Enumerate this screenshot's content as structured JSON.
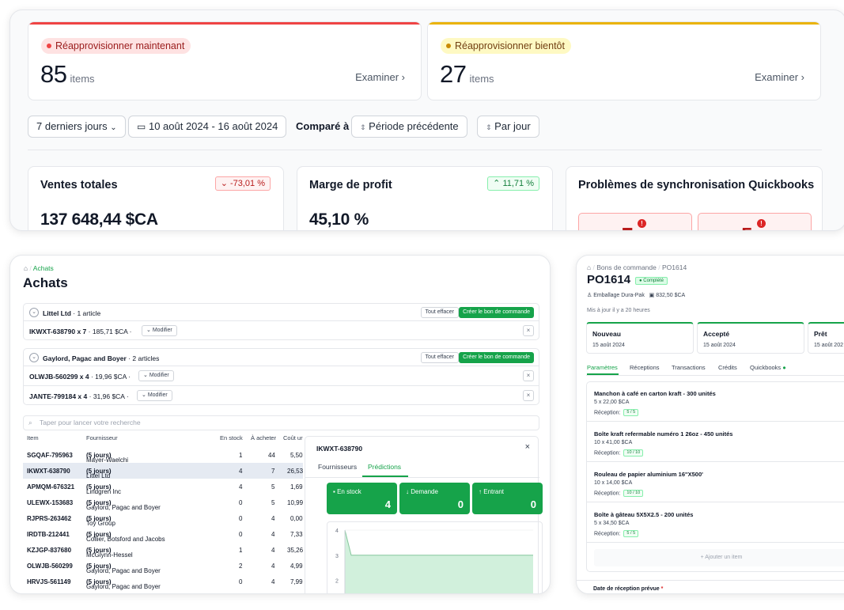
{
  "top": {
    "restock_now": {
      "label": "Réapprovisionner maintenant",
      "count": "85",
      "unit": "items",
      "action": "Examiner",
      "color": "#ef4444"
    },
    "restock_soon": {
      "label": "Réapprovisionner bientôt",
      "count": "27",
      "unit": "items",
      "action": "Examiner",
      "color": "#eab308"
    },
    "filters": {
      "range": "7 derniers jours",
      "dates": "10 août 2024 - 16 août 2024",
      "compare_label": "Comparé à",
      "compare": "Période précédente",
      "granularity": "Par jour"
    },
    "metrics": [
      {
        "title": "Ventes totales",
        "value": "137 648,44 $CA",
        "delta": "-73,01 %"
      },
      {
        "title": "Marge de profit",
        "value": "45,10 %",
        "delta": "11,71 %"
      },
      {
        "title": "Problèmes de synchronisation Quickbooks",
        "tiles": [
          "7",
          "5"
        ]
      }
    ]
  },
  "achats": {
    "breadcrumb": "Achats",
    "title": "Achats",
    "groups": [
      {
        "supplier": "Littel Ltd",
        "count": "1 article",
        "clear": "Tout effacer",
        "create": "Créer le bon de commande",
        "lines": [
          {
            "sku": "IKWXT-638790 x 7",
            "price": "185,71 $CA",
            "edit": "Modifier"
          }
        ]
      },
      {
        "supplier": "Gaylord, Pagac and Boyer",
        "count": "2 articles",
        "clear": "Tout effacer",
        "create": "Créer le bon de commande",
        "lines": [
          {
            "sku": "OLWJB-560299 x 4",
            "price": "19,96 $CA",
            "edit": "Modifier"
          },
          {
            "sku": "JANTE-799184 x 4",
            "price": "31,96 $CA",
            "edit": "Modifier"
          }
        ]
      }
    ],
    "search_placeholder": "Taper pour lancer votre recherche",
    "columns": [
      "Item",
      "Fournisseur",
      "En stock",
      "À acheter",
      "Coût ur"
    ],
    "rows": [
      {
        "item": "SGQAF-795963",
        "supplier": "Mayer-Waelchi",
        "lead": "(5 jours)",
        "stock": "1",
        "buy": "44",
        "cost": "5,50"
      },
      {
        "item": "IKWXT-638790",
        "supplier": "Littel Ltd",
        "lead": "(5 jours)",
        "stock": "4",
        "buy": "7",
        "cost": "26,53"
      },
      {
        "item": "APMQM-676321",
        "supplier": "Lindgren Inc",
        "lead": "(5 jours)",
        "stock": "4",
        "buy": "5",
        "cost": "1,69"
      },
      {
        "item": "ULEWX-153683",
        "supplier": "Gaylord, Pagac and Boyer",
        "lead": "(5 jours)",
        "stock": "0",
        "buy": "5",
        "cost": "10,99"
      },
      {
        "item": "RJPRS-263462",
        "supplier": "Toy Group",
        "lead": "(5 jours)",
        "stock": "0",
        "buy": "4",
        "cost": "0,00"
      },
      {
        "item": "IRDTB-212441",
        "supplier": "Collier, Botsford and Jacobs",
        "lead": "(5 jours)",
        "stock": "0",
        "buy": "4",
        "cost": "7,33"
      },
      {
        "item": "KZJGP-837680",
        "supplier": "McGlynn-Hessel",
        "lead": "(5 jours)",
        "stock": "1",
        "buy": "4",
        "cost": "35,26"
      },
      {
        "item": "OLWJB-560299",
        "supplier": "Gaylord, Pagac and Boyer",
        "lead": "(5 jours)",
        "stock": "2",
        "buy": "4",
        "cost": "4,99"
      },
      {
        "item": "HRVJS-561149",
        "supplier": "Gaylord, Pagac and Boyer",
        "lead": "(5 jours)",
        "stock": "0",
        "buy": "4",
        "cost": "7,99"
      }
    ],
    "side": {
      "title": "IKWXT-638790",
      "tabs": [
        "Fournisseurs",
        "Prédictions"
      ],
      "cards": [
        {
          "label": "En stock",
          "value": "4"
        },
        {
          "label": "Demande",
          "value": "0"
        },
        {
          "label": "Entrant",
          "value": "0"
        }
      ],
      "chart_data": {
        "type": "area",
        "y_ticks": [
          "4",
          "3",
          "2",
          "1"
        ],
        "ylim": [
          0,
          4
        ],
        "values": [
          4,
          3,
          3,
          3,
          3,
          3,
          3,
          3
        ]
      }
    }
  },
  "po": {
    "breadcrumb_parent": "Bons de commande",
    "breadcrumb_current": "PO1614",
    "title": "PO1614",
    "status": "Complété",
    "supplier": "Emballage Dura-Pak",
    "total": "832,50 $CA",
    "updated": "Mis à jour il y a 20 heures",
    "stages": [
      {
        "name": "Nouveau",
        "date": "15 août 2024"
      },
      {
        "name": "Accepté",
        "date": "15 août 2024"
      },
      {
        "name": "Prêt",
        "date": "15 août 202"
      }
    ],
    "tabs": [
      "Paramètres",
      "Réceptions",
      "Transactions",
      "Crédits",
      "Quickbooks"
    ],
    "items": [
      {
        "name": "Manchon à café en carton kraft - 300 unités",
        "qty": "5 x 22,00 $CA",
        "reception_label": "Réception:",
        "reception": "5 / 5"
      },
      {
        "name": "Boîte kraft refermable numéro 1 26oz - 450 unités",
        "qty": "10 x 41,00 $CA",
        "reception_label": "Réception:",
        "reception": "10 / 10"
      },
      {
        "name": "Rouleau de papier aluminium 16''X500'",
        "qty": "10 x 14,00 $CA",
        "reception_label": "Réception:",
        "reception": "10 / 10"
      },
      {
        "name": "Boîte à gâteau 5X5X2.5 - 200 unités",
        "qty": "5 x 34,50 $CA",
        "reception_label": "Réception:",
        "reception": "5 / 5"
      }
    ],
    "add_item": "+ Ajouter un item",
    "date_label": "Date de réception prévue",
    "date_required": "*"
  }
}
